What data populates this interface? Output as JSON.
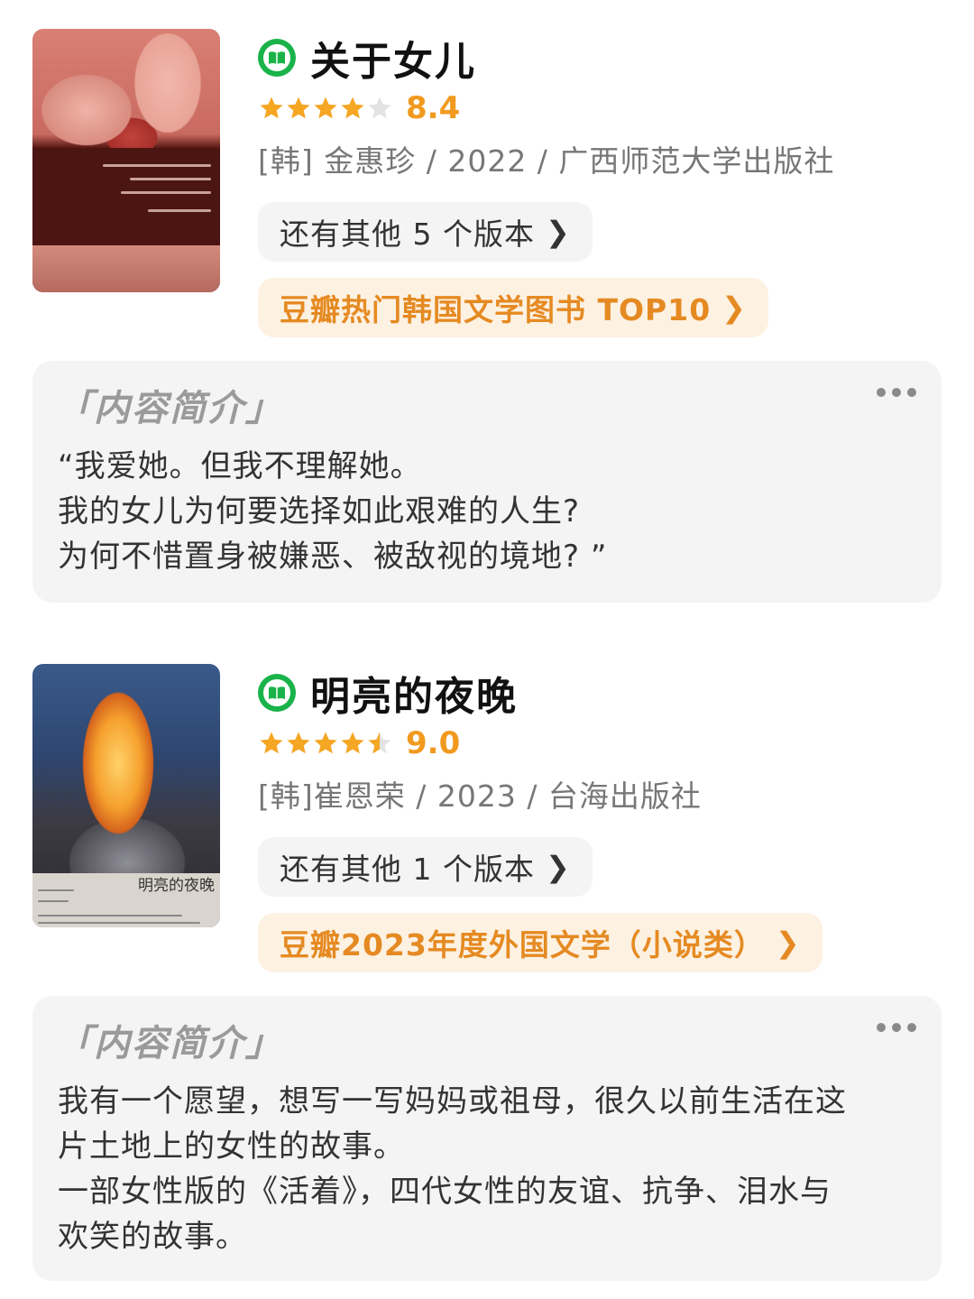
{
  "accent_colors": {
    "green": "#19b34a",
    "star": "#f5a623",
    "rating": "#f29a1f",
    "tag": "#e58a22"
  },
  "books": [
    {
      "title": "关于女儿",
      "rating": "8.4",
      "stars": 4,
      "meta": "[韩] 金惠珍 / 2022 / 广西师范大学出版社",
      "editions_label": "还有其他 5 个版本",
      "rank_label": "豆瓣热门韩国文学图书 TOP10",
      "intro_heading": "「内容简介」",
      "intro_lines": [
        "“我爱她。但我不理解她。",
        "我的女儿为何要选择如此艰难的人生?",
        "为何不惜置身被嫌恶、被敌视的境地? ”"
      ]
    },
    {
      "title": "明亮的夜晚",
      "rating": "9.0",
      "stars": 4.5,
      "meta": "[韩]崔恩荣 / 2023 / 台海出版社",
      "editions_label": "还有其他 1 个版本",
      "rank_label": "豆瓣2023年度外国文学（小说类）",
      "intro_heading": "「内容简介」",
      "intro_lines": [
        "我有一个愿望，想写一写妈妈或祖母，很久以前生活在这",
        "片土地上的女性的故事。",
        "一部女性版的《活着》，四代女性的友谊、抗争、泪水与",
        "欢笑的故事。"
      ],
      "cover_title": "明亮的夜晚"
    }
  ]
}
